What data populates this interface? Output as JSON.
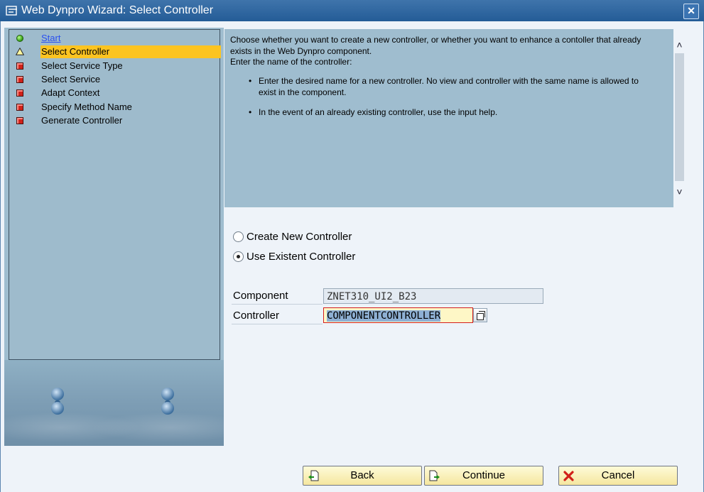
{
  "window": {
    "title": "Web Dynpro Wizard: Select Controller",
    "close_label": "✕"
  },
  "steps": [
    {
      "label": "Start",
      "status": "done",
      "icon": "green-status-icon"
    },
    {
      "label": "Select Controller",
      "status": "current",
      "icon": "warning-triangle-icon"
    },
    {
      "label": "Select Service Type",
      "status": "pending",
      "icon": "red-status-icon"
    },
    {
      "label": "Select Service",
      "status": "pending",
      "icon": "red-status-icon"
    },
    {
      "label": "Adapt Context",
      "status": "pending",
      "icon": "red-status-icon"
    },
    {
      "label": "Specify Method Name",
      "status": "pending",
      "icon": "red-status-icon"
    },
    {
      "label": "Generate Controller",
      "status": "pending",
      "icon": "red-status-icon"
    }
  ],
  "info": {
    "intro": "Choose whether you want to create a new controller, or whether you want to enhance a contoller that already exists in the Web Dynpro component.",
    "intro2": "Enter the name of the controller:",
    "bullets": [
      "Enter the desired name for a new controller. No view and controller with the same name is allowed to exist in the component.",
      "In the event of an already existing controller, use the input help."
    ]
  },
  "options": {
    "create_new": {
      "label": "Create New Controller",
      "selected": false
    },
    "use_existent": {
      "label": "Use Existent Controller",
      "selected": true
    }
  },
  "fields": {
    "component": {
      "label": "Component",
      "value": "ZNET310_UI2_B23"
    },
    "controller": {
      "label": "Controller",
      "value": "COMPONENTCONTROLLER"
    }
  },
  "buttons": {
    "back": "Back",
    "continue": "Continue",
    "cancel": "Cancel"
  },
  "colors": {
    "title_bar": "#245c97",
    "panel": "#9fbdcf",
    "active_step": "#fcc421",
    "button": "#f5e69f"
  }
}
